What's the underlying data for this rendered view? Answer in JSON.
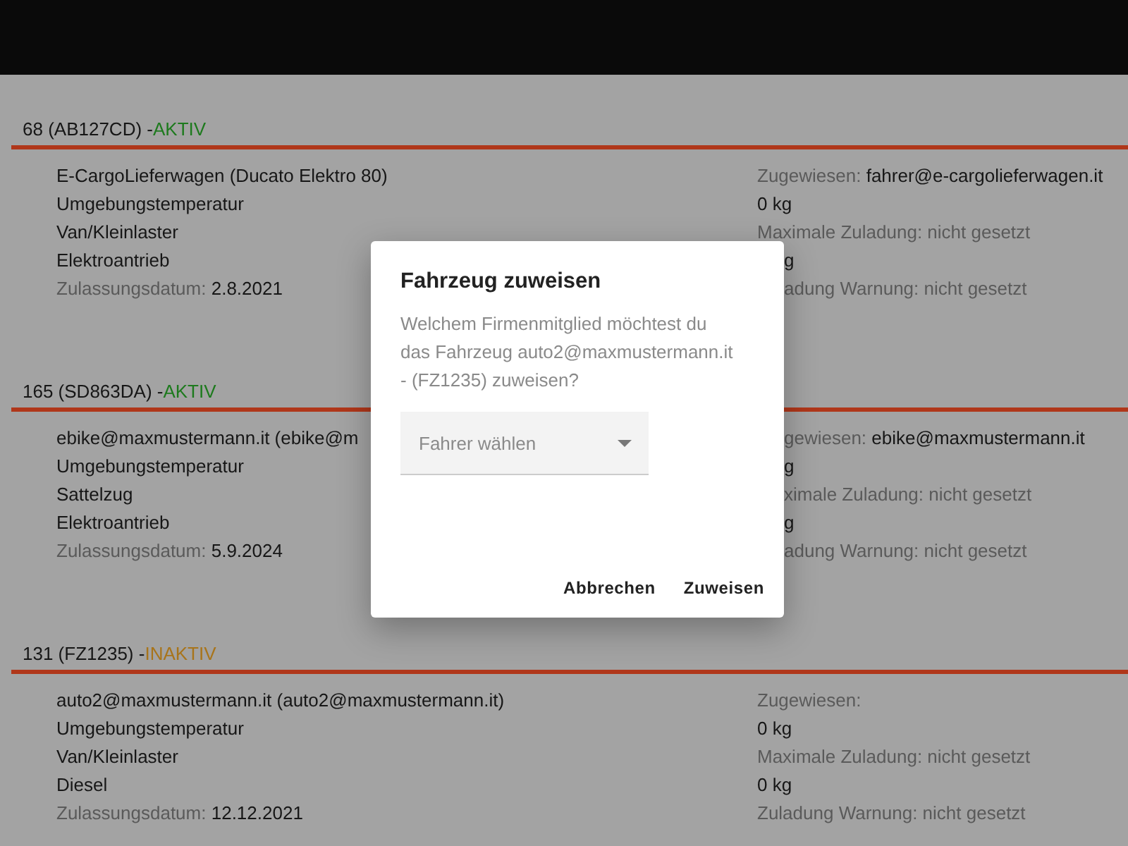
{
  "vehicles": [
    {
      "title": "68 (AB127CD) -",
      "status": "AKTIV",
      "color": "#1d7a1d",
      "left": [
        {
          "value": "E-CargoLieferwagen (Ducato Elektro 80)"
        },
        {
          "value": "Umgebungstemperatur"
        },
        {
          "value": "Van/Kleinlaster"
        },
        {
          "value": "Elektroantrieb"
        },
        {
          "label": "Zulassungsdatum:",
          "value": "2.8.2021"
        }
      ],
      "right": [
        {
          "kind": "full",
          "label": "Zugewiesen:",
          "value": "fahrer@e-cargolieferwagen.it"
        },
        {
          "kind": "full",
          "value": "0 kg"
        },
        {
          "kind": "full",
          "label": "Maximale Zuladung: nicht gesetzt"
        },
        {
          "kind": "partial",
          "value": "g"
        },
        {
          "kind": "partial",
          "label": "adung Warnung: nicht gesetzt"
        }
      ]
    },
    {
      "title": "165 (SD863DA) -",
      "status": "AKTIV",
      "color": "#1d7a1d",
      "left": [
        {
          "value": "ebike@maxmustermann.it (ebike@m"
        },
        {
          "value": "Umgebungstemperatur"
        },
        {
          "value": "Sattelzug"
        },
        {
          "value": "Elektroantrieb"
        },
        {
          "label": "Zulassungsdatum:",
          "value": "5.9.2024"
        }
      ],
      "right": [
        {
          "kind": "partial",
          "label": "gewiesen:",
          "value": "ebike@maxmustermann.it"
        },
        {
          "kind": "partial",
          "value": "g"
        },
        {
          "kind": "partial",
          "label": "ximale Zuladung: nicht gesetzt"
        },
        {
          "kind": "partial",
          "value": "g"
        },
        {
          "kind": "partial",
          "label": "adung Warnung: nicht gesetzt"
        }
      ]
    },
    {
      "title": "131 (FZ1235) -",
      "status": "INAKTIV",
      "color": "#a8741a",
      "left": [
        {
          "value": "auto2@maxmustermann.it (auto2@maxmustermann.it)"
        },
        {
          "value": "Umgebungstemperatur"
        },
        {
          "value": "Van/Kleinlaster"
        },
        {
          "value": "Diesel"
        },
        {
          "label": "Zulassungsdatum:",
          "value": "12.12.2021"
        }
      ],
      "right": [
        {
          "kind": "full",
          "label": "Zugewiesen:"
        },
        {
          "kind": "full",
          "value": "0 kg"
        },
        {
          "kind": "full",
          "label": "Maximale Zuladung: nicht gesetzt"
        },
        {
          "kind": "full",
          "value": "0 kg"
        },
        {
          "kind": "full",
          "label": "Zuladung Warnung: nicht gesetzt"
        }
      ]
    }
  ],
  "dialog": {
    "title": "Fahrzeug zuweisen",
    "message": "Welchem Firmenmitglied möchtest du das Fahrzeug auto2@maxmustermann.it - (FZ1235) zuweisen?",
    "select": {
      "placeholder": "Fahrer wählen"
    },
    "buttons": [
      "Abbrechen",
      "Zuweisen"
    ]
  }
}
